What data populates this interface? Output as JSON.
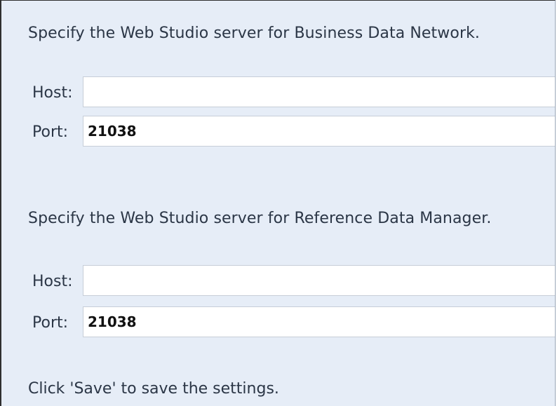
{
  "bdn": {
    "heading": "Specify the Web Studio server for Business Data Network.",
    "host_label": "Host:",
    "host_value": "",
    "port_label": "Port:",
    "port_value": "21038"
  },
  "rdm": {
    "heading": "Specify the Web Studio server for Reference Data Manager.",
    "host_label": "Host:",
    "host_value": "",
    "port_label": "Port:",
    "port_value": "21038"
  },
  "footer": {
    "text": "Click 'Save' to save the settings."
  }
}
